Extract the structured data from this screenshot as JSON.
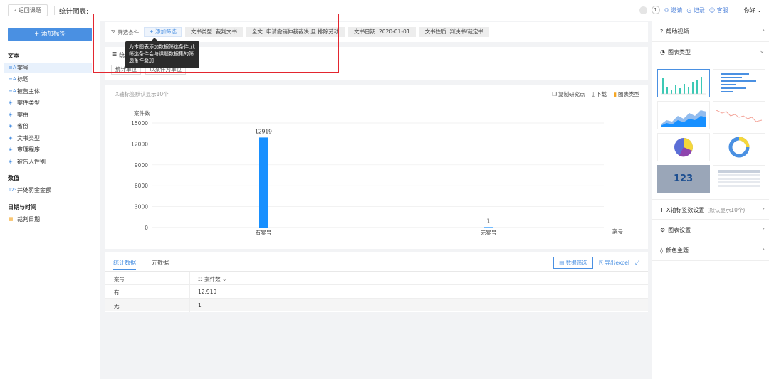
{
  "topbar": {
    "back_label": "返回课题",
    "title": "统计图表:",
    "count": "1",
    "invite": "邀请",
    "record": "记录",
    "service": "客服",
    "user": "你好"
  },
  "left": {
    "add_tag": "+ 添加标签",
    "groups": {
      "text": "文本",
      "number": "数值",
      "datetime": "日期与时间"
    },
    "text_items": [
      "案号",
      "标题",
      "被告主体",
      "案件类型",
      "案由",
      "省份",
      "文书类型",
      "审理程序",
      "被告人性别"
    ],
    "number_items": [
      "并处罚金金额"
    ],
    "date_items": [
      "裁判日期"
    ]
  },
  "filter": {
    "label": "筛选条件",
    "add_label": "+ 添加筛选",
    "chips": [
      "文书类型: 裁判文书",
      "全文: 申请撤销仲裁裁决 且 排除劳动",
      "文书日期: 2020-01-01",
      "文书性质: 判决书/裁定书"
    ],
    "tooltip": "为本图表添加数据筛选条件,此筛选条件会与课题数据集的筛选条件叠加",
    "sub_title": "统",
    "sub_btn1": "统计单位",
    "sub_btn2": "以案件为单位"
  },
  "chart_card": {
    "hint": "X轴标签默认显示10个",
    "actions": [
      "复制研究点",
      "下载",
      "图表类型"
    ]
  },
  "chart_data": {
    "type": "bar",
    "ylabel": "案件数",
    "xlabel": "案号",
    "categories": [
      "有案号",
      "无案号"
    ],
    "values": [
      12919,
      1
    ],
    "ylim": [
      0,
      15000
    ],
    "yticks": [
      "0",
      "3000",
      "6000",
      "9000",
      "12000",
      "15000"
    ],
    "data_labels": [
      "12919",
      "1"
    ],
    "bar_color": "#1890ff",
    "grid": true
  },
  "table": {
    "tabs": [
      "统计数据",
      "元数据"
    ],
    "btn_filter": "数据筛选",
    "btn_export": "导出excel",
    "headers": [
      "案号",
      "案件数"
    ],
    "rows": [
      [
        "有",
        "12,919"
      ],
      [
        "无",
        "1"
      ]
    ]
  },
  "right": {
    "help_video": "帮助视频",
    "chart_type": "图表类型",
    "thumb_123": "123",
    "x_label_setting": "X轴标签数设置",
    "x_label_hint": "(默认显示10个)",
    "chart_setting": "图表设置",
    "color_theme": "颜色主题"
  },
  "colors": {
    "accent": "#4a90e2",
    "highlight": "#e3262f"
  }
}
